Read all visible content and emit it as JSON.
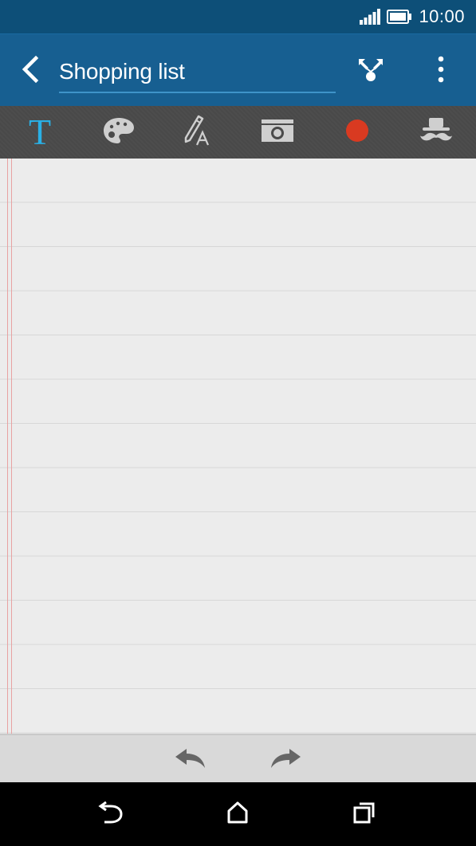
{
  "status_bar": {
    "time": "10:00",
    "icons": [
      "signal-icon",
      "battery-icon"
    ]
  },
  "app_bar": {
    "title": "Shopping list",
    "icons": [
      "back-arrow-icon",
      "share-icon",
      "overflow-menu-icon"
    ]
  },
  "toolbar": {
    "text_tool_glyph": "T",
    "tools": [
      "text-tool-icon",
      "palette-icon",
      "pen-handwriting-icon",
      "camera-icon",
      "record-icon",
      "hat-mustache-icon"
    ],
    "active_tool": "text-tool-icon",
    "colors": {
      "active": "#29b0e6",
      "inactive": "#cfcfcf",
      "record": "#d93a21"
    }
  },
  "paper": {
    "style": "ruled notepad",
    "margin_color": "#e8a2a2",
    "rule_color": "#d7d7d7"
  },
  "bottom_bar": {
    "icons": [
      "undo-icon",
      "redo-icon"
    ]
  },
  "nav_bar": {
    "icons": [
      "back-icon",
      "home-icon",
      "recent-apps-icon"
    ]
  },
  "colors": {
    "status_bar": "#0d4f78",
    "app_bar": "#175f91",
    "title_underline": "#3e93c9",
    "toolbar": "#4a4a4a",
    "paper": "#ececec"
  }
}
